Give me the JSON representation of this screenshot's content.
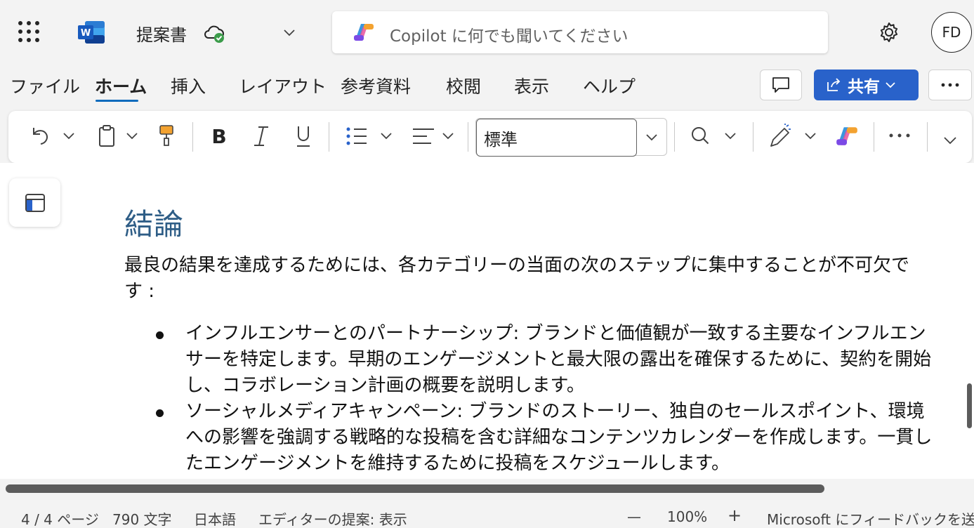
{
  "app": {
    "doc_title": "提案書",
    "user_initials": "FD"
  },
  "search": {
    "placeholder": "Copilot に何でも聞いてください"
  },
  "ribbon": {
    "tabs": [
      "ファイル",
      "ホーム",
      "挿入",
      "レイアウト",
      "参考資料",
      "校閲",
      "表示",
      "ヘルプ"
    ],
    "active_tab": "ホーム",
    "share_label": "共有"
  },
  "toolbar": {
    "style_value": "標準",
    "buttons": [
      "undo-icon",
      "clipboard-icon",
      "format-painter-icon",
      "bold-icon",
      "italic-icon",
      "underline-icon",
      "bullets-icon",
      "align-icon",
      "find-icon",
      "editor-pen-icon",
      "copilot-icon",
      "more-icon",
      "expand-icon"
    ]
  },
  "document": {
    "heading": "結論",
    "paragraph": "最良の結果を達成するためには、各カテゴリーの当面の次のステップに集中することが不可欠です :",
    "bullets": [
      "インフルエンサーとのパートナーシップ: ブランドと価値観が一致する主要なインフルエンサーを特定します。早期のエンゲージメントと最大限の露出を確保するために、契約を開始し、コラボレーション計画の概要を説明します。",
      "ソーシャルメディアキャンペーン: ブランドのストーリー、独自のセールスポイント、環境への影響を強調する戦略的な投稿を含む詳細なコンテンツカレンダーを作成します。一貫したエンゲージメントを維持するために投稿をスケジュールします。"
    ]
  },
  "status": {
    "page": "4 / 4 ページ",
    "words": "790 文字",
    "language": "日本語",
    "editor": "エディターの提案: 表示",
    "zoom_out": "—",
    "zoom": "100%",
    "zoom_in": "+",
    "feedback": "Microsoft にフィードバックを送信"
  },
  "colors": {
    "accent": "#0f6cbd",
    "share": "#2962ca",
    "heading": "#2e5d86",
    "word_blue": "#185abd"
  }
}
